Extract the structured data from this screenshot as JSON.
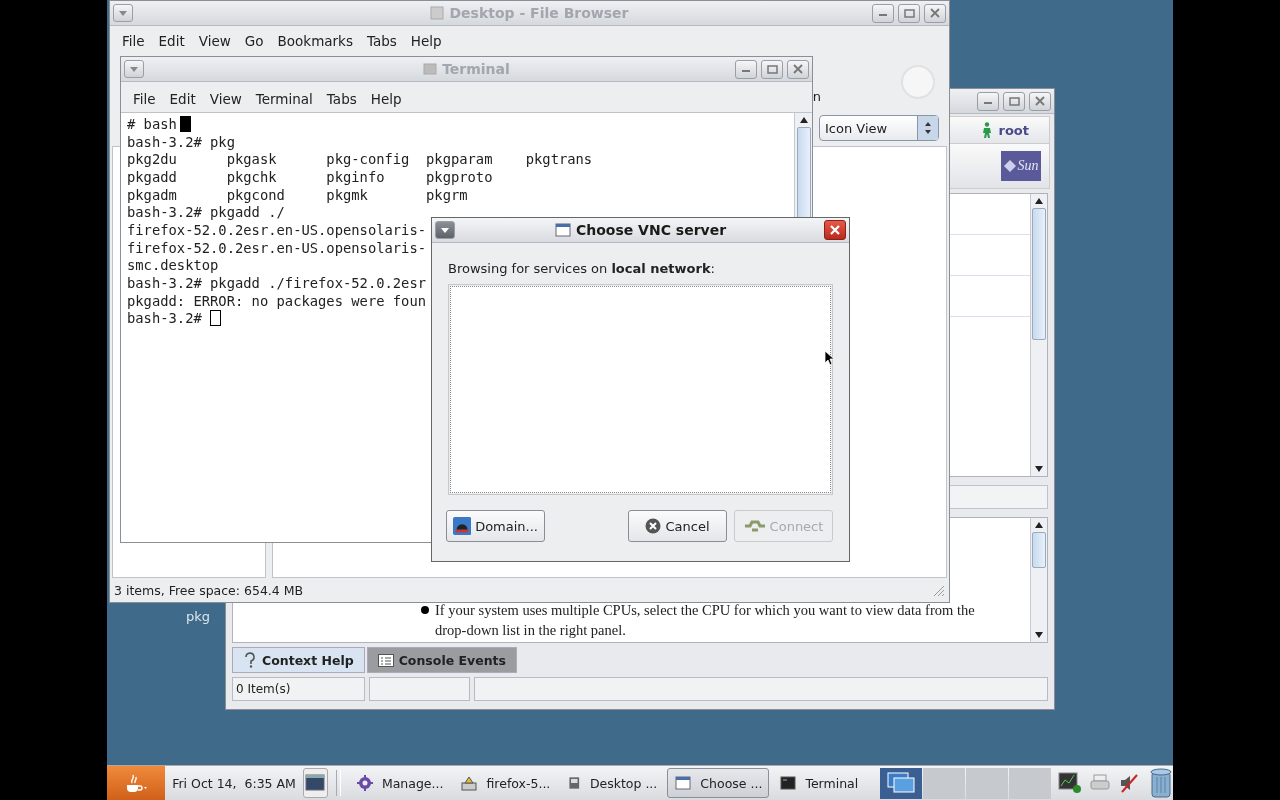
{
  "desktop_icons": [
    {
      "label": "pkg"
    }
  ],
  "console_window": {
    "user": "root",
    "logo_text": "Sun",
    "help_text": "If your system uses multiple CPUs, select the CPU for which you want to view data from the drop-down list in the right panel.",
    "tabs": [
      {
        "label": "Context Help",
        "kind": "help",
        "selected": true
      },
      {
        "label": "Console Events",
        "kind": "events",
        "selected": false
      }
    ],
    "status": "0 Item(s)"
  },
  "file_browser": {
    "title": "Desktop - File Browser",
    "menu": [
      "File",
      "Edit",
      "View",
      "Go",
      "Bookmarks",
      "Tabs",
      "Help"
    ],
    "partial_text": "n",
    "view_mode": "Icon View",
    "status": "3 items, Free space: 654.4 MB"
  },
  "terminal": {
    "title": "Terminal",
    "menu": [
      "File",
      "Edit",
      "View",
      "Terminal",
      "Tabs",
      "Help"
    ],
    "lines": [
      {
        "text": "# bash",
        "cursor": true,
        "filled": true
      },
      {
        "text": "bash-3.2# pkg",
        "cursor": false
      },
      {
        "text": "pkg2du      pkgask      pkg-config  pkgparam    pkgtrans",
        "cursor": false
      },
      {
        "text": "pkgadd      pkgchk      pkginfo     pkgproto",
        "cursor": false
      },
      {
        "text": "pkgadm      pkgcond     pkgmk       pkgrm",
        "cursor": false
      },
      {
        "text": "bash-3.2# pkgadd ./",
        "cursor": false
      },
      {
        "text": "firefox-52.0.2esr.en-US.opensolaris-",
        "cursor": false
      },
      {
        "text": "firefox-52.0.2esr.en-US.opensolaris-",
        "cursor": false
      },
      {
        "text": "smc.desktop",
        "cursor": false
      },
      {
        "text": "bash-3.2# pkgadd ./firefox-52.0.2esr",
        "cursor": false
      },
      {
        "text": "pkgadd: ERROR: no packages were foun",
        "cursor": false
      },
      {
        "text": "bash-3.2# ",
        "cursor": true,
        "filled": false
      }
    ]
  },
  "dialog": {
    "title": "Choose VNC server",
    "prompt": "Browsing for services on **local network**:",
    "buttons": [
      {
        "label": "Domain...",
        "kind": "domain",
        "disabled": false
      },
      {
        "label": "Cancel",
        "kind": "cancel",
        "disabled": false
      },
      {
        "label": "Connect",
        "kind": "connect",
        "disabled": true
      }
    ]
  },
  "taskbar": {
    "clock": "Fri Oct 14,  6:35 AM",
    "tasks": [
      {
        "label": "Manage...",
        "kind": "console",
        "selected": false
      },
      {
        "label": "firefox-5...",
        "kind": "package",
        "selected": false
      },
      {
        "label": "Desktop ...",
        "kind": "files",
        "selected": false
      },
      {
        "label": "Choose ...",
        "kind": "dialog",
        "selected": true
      },
      {
        "label": "Terminal",
        "kind": "terminal",
        "selected": false
      }
    ],
    "workspaces": [
      {
        "selected": true
      },
      {
        "selected": false
      },
      {
        "selected": false
      },
      {
        "selected": false
      }
    ]
  }
}
